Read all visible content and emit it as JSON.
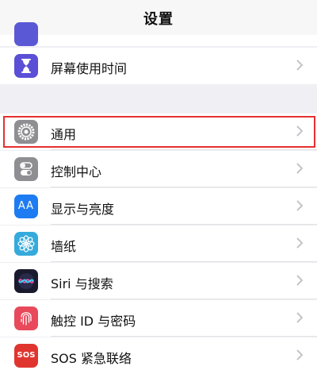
{
  "nav": {
    "title": "设置"
  },
  "rows": [
    {
      "label": "屏幕使用时间",
      "icon": "hourglass-icon",
      "color": "#5a4fd6"
    },
    {
      "label": "通用",
      "icon": "gear-icon",
      "color": "#8e8e93"
    },
    {
      "label": "控制中心",
      "icon": "toggle-switches-icon",
      "color": "#8e8e93"
    },
    {
      "label": "显示与亮度",
      "icon": "text-size-aa-icon",
      "color": "#1d7cf2",
      "icon_text": "AA"
    },
    {
      "label": "墙纸",
      "icon": "flower-icon",
      "color": "#35aadc"
    },
    {
      "label": "Siri 与搜索",
      "icon": "siri-icon",
      "color": "#1a1a2e"
    },
    {
      "label": "触控 ID 与密码",
      "icon": "fingerprint-icon",
      "color": "#e8495b"
    },
    {
      "label": "SOS 紧急联络",
      "icon": "sos-icon",
      "color": "#e0352f",
      "icon_text": "SOS"
    }
  ],
  "highlight_color": "#e5302f"
}
